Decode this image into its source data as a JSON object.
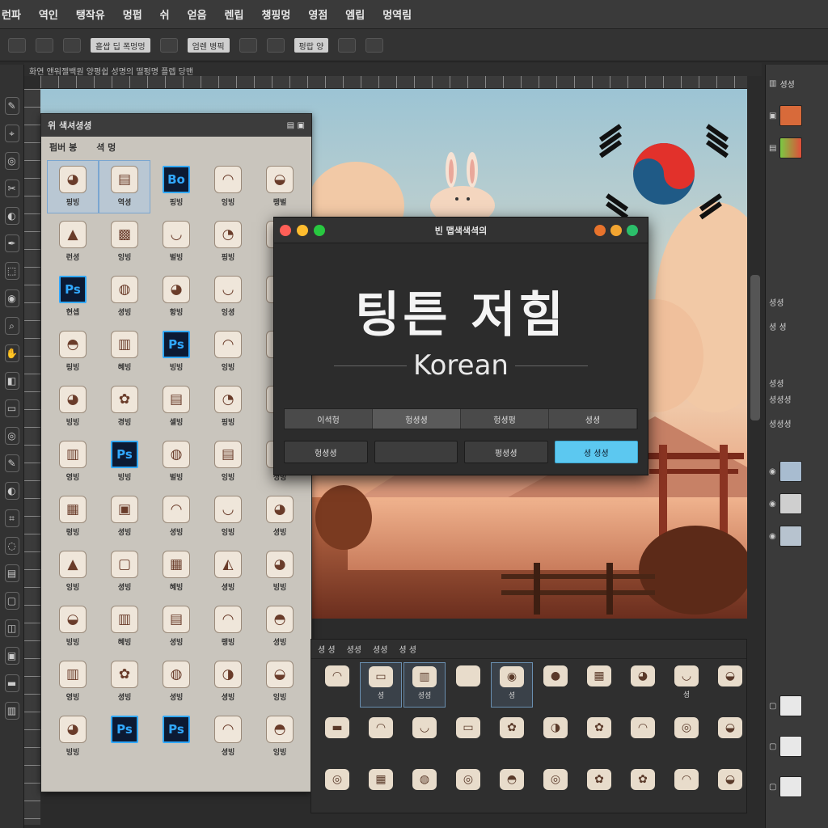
{
  "menu": [
    "런파",
    "역인",
    "탱작유",
    "멍펍",
    "쉬",
    "얻음",
    "렌립",
    "챙핑멍",
    "영점",
    "엠립",
    "멍역림"
  ],
  "options": {
    "field1": "흩쌉 딥 폭멍멍",
    "field2": "엄렌 병픽",
    "field3": "펑랍 양"
  },
  "document_tab": "화연 앤워젤백원 양평쉽 성명의 떨펑명 플렙 당맨",
  "tools": [
    "✎",
    "⌖",
    "◎",
    "✂",
    "◐",
    "✒",
    "⬚",
    "◉",
    "⌕",
    "✋",
    "◧",
    "▭",
    "◎",
    "✎",
    "◐",
    "⌗",
    "◌",
    "▤",
    "▢",
    "◫",
    "▣",
    "▬",
    "▥"
  ],
  "left_panel": {
    "title": "위 색셔셩셩",
    "sub_tabs": [
      "펌버 봉",
      "셕 멍"
    ],
    "icons": [
      {
        "g": "◕",
        "l": "핑빙",
        "ps": false,
        "sel": true
      },
      {
        "g": "▤",
        "l": "역셩",
        "ps": false,
        "sel": true
      },
      {
        "g": "Bo",
        "l": "핑빙",
        "ps": true,
        "sel": false
      },
      {
        "g": "◠",
        "l": "잉빙",
        "ps": false,
        "sel": false
      },
      {
        "g": "◒",
        "l": "랭벌",
        "ps": false,
        "sel": false
      },
      {
        "g": "▲",
        "l": "런셩",
        "ps": false,
        "sel": false
      },
      {
        "g": "▩",
        "l": "잉빙",
        "ps": false,
        "sel": false
      },
      {
        "g": "◡",
        "l": "벌빙",
        "ps": false,
        "sel": false
      },
      {
        "g": "◔",
        "l": "핑빙",
        "ps": false,
        "sel": false
      },
      {
        "g": "◑",
        "l": "셀빙",
        "ps": false,
        "sel": false
      },
      {
        "g": "Ps",
        "l": "현셉",
        "ps": true,
        "sel": false
      },
      {
        "g": "◍",
        "l": "셩빙",
        "ps": false,
        "sel": false
      },
      {
        "g": "◕",
        "l": "항빙",
        "ps": false,
        "sel": false
      },
      {
        "g": "◡",
        "l": "잉셩",
        "ps": false,
        "sel": false
      },
      {
        "g": "◐",
        "l": "셩빙",
        "ps": false,
        "sel": false
      },
      {
        "g": "◓",
        "l": "링빙",
        "ps": false,
        "sel": false
      },
      {
        "g": "▥",
        "l": "혜빙",
        "ps": false,
        "sel": false
      },
      {
        "g": "Ps",
        "l": "빙빙",
        "ps": true,
        "sel": false
      },
      {
        "g": "◠",
        "l": "잉빙",
        "ps": false,
        "sel": false
      },
      {
        "g": "◑",
        "l": "셩빙",
        "ps": false,
        "sel": false
      },
      {
        "g": "◕",
        "l": "빙빙",
        "ps": false,
        "sel": false
      },
      {
        "g": "✿",
        "l": "경빙",
        "ps": false,
        "sel": false
      },
      {
        "g": "▤",
        "l": "셀빙",
        "ps": false,
        "sel": false
      },
      {
        "g": "◔",
        "l": "핑빙",
        "ps": false,
        "sel": false
      },
      {
        "g": "◒",
        "l": "셩빙",
        "ps": false,
        "sel": false
      },
      {
        "g": "▥",
        "l": "영빙",
        "ps": false,
        "sel": false
      },
      {
        "g": "Ps",
        "l": "빙빙",
        "ps": true,
        "sel": false
      },
      {
        "g": "◍",
        "l": "벌빙",
        "ps": false,
        "sel": false
      },
      {
        "g": "▤",
        "l": "잉빙",
        "ps": false,
        "sel": false
      },
      {
        "g": "◑",
        "l": "셩빙",
        "ps": false,
        "sel": false
      },
      {
        "g": "▦",
        "l": "렁빙",
        "ps": false,
        "sel": false
      },
      {
        "g": "▣",
        "l": "셩빙",
        "ps": false,
        "sel": false
      },
      {
        "g": "◠",
        "l": "셩빙",
        "ps": false,
        "sel": false
      },
      {
        "g": "◡",
        "l": "잉빙",
        "ps": false,
        "sel": false
      },
      {
        "g": "◕",
        "l": "셩빙",
        "ps": false,
        "sel": false
      },
      {
        "g": "▲",
        "l": "잉빙",
        "ps": false,
        "sel": false
      },
      {
        "g": "▢",
        "l": "셩빙",
        "ps": false,
        "sel": false
      },
      {
        "g": "▦",
        "l": "혜빙",
        "ps": false,
        "sel": false
      },
      {
        "g": "◭",
        "l": "셩빙",
        "ps": false,
        "sel": false
      },
      {
        "g": "◕",
        "l": "빙빙",
        "ps": false,
        "sel": false
      },
      {
        "g": "◒",
        "l": "빙빙",
        "ps": false,
        "sel": false
      },
      {
        "g": "▥",
        "l": "혜빙",
        "ps": false,
        "sel": false
      },
      {
        "g": "▤",
        "l": "셩빙",
        "ps": false,
        "sel": false
      },
      {
        "g": "◠",
        "l": "랭빙",
        "ps": false,
        "sel": false
      },
      {
        "g": "◓",
        "l": "셩빙",
        "ps": false,
        "sel": false
      },
      {
        "g": "▥",
        "l": "영빙",
        "ps": false,
        "sel": false
      },
      {
        "g": "✿",
        "l": "셩빙",
        "ps": false,
        "sel": false
      },
      {
        "g": "◍",
        "l": "셩빙",
        "ps": false,
        "sel": false
      },
      {
        "g": "◑",
        "l": "셩빙",
        "ps": false,
        "sel": false
      },
      {
        "g": "◒",
        "l": "잉빙",
        "ps": false,
        "sel": false
      },
      {
        "g": "◕",
        "l": "빙빙",
        "ps": false,
        "sel": false
      },
      {
        "g": "Ps",
        "l": "",
        "ps": true,
        "sel": false
      },
      {
        "g": "Ps",
        "l": "",
        "ps": true,
        "sel": false
      },
      {
        "g": "◠",
        "l": "셩빙",
        "ps": false,
        "sel": false
      },
      {
        "g": "◓",
        "l": "잉빙",
        "ps": false,
        "sel": false
      }
    ]
  },
  "dialog": {
    "title": "빈 맵색색셕의",
    "heading": "팅튼 저힘",
    "subheading": "Korean",
    "tabs": [
      "이셕헝",
      "헝셩셩",
      "헝셩펑",
      "셩셩"
    ],
    "buttons": [
      "헝셩셩",
      "",
      "펑셩셩",
      "셩 셩셩"
    ],
    "colors": {
      "close": "#ff5f57",
      "min": "#febc2e",
      "max": "#28c840"
    }
  },
  "right_panel": {
    "rows": [
      "셩셩",
      "셩셩",
      "셩 셩",
      "셩셩",
      "셩셩셩",
      "셩셩셩"
    ]
  },
  "bottom_panel": {
    "tabs": [
      "셩 셩",
      "셩셩",
      "셩셩",
      "셩 셩"
    ],
    "icons": [
      {
        "g": "◠",
        "l": "",
        "sel": false
      },
      {
        "g": "▭",
        "l": "셩",
        "sel": true
      },
      {
        "g": "▥",
        "l": "셩셩",
        "sel": true
      },
      {
        "g": "",
        "l": "",
        "sel": false
      },
      {
        "g": "◉",
        "l": "셩",
        "sel": true
      },
      {
        "g": "●",
        "l": "",
        "sel": false
      },
      {
        "g": "▦",
        "l": "",
        "sel": false
      },
      {
        "g": "◕",
        "l": "",
        "sel": false
      },
      {
        "g": "◡",
        "l": "셩",
        "sel": false
      },
      {
        "g": "◒",
        "l": "",
        "sel": false
      },
      {
        "g": "▬",
        "l": "",
        "sel": false
      },
      {
        "g": "◠",
        "l": "",
        "sel": false
      },
      {
        "g": "◡",
        "l": "",
        "sel": false
      },
      {
        "g": "▭",
        "l": "",
        "sel": false
      },
      {
        "g": "✿",
        "l": "",
        "sel": false
      },
      {
        "g": "◑",
        "l": "",
        "sel": false
      },
      {
        "g": "✿",
        "l": "",
        "sel": false
      },
      {
        "g": "◠",
        "l": "",
        "sel": false
      },
      {
        "g": "◎",
        "l": "",
        "sel": false
      },
      {
        "g": "◒",
        "l": "",
        "sel": false
      },
      {
        "g": "◎",
        "l": "",
        "sel": false
      },
      {
        "g": "▦",
        "l": "",
        "sel": false
      },
      {
        "g": "◍",
        "l": "",
        "sel": false
      },
      {
        "g": "◎",
        "l": "",
        "sel": false
      },
      {
        "g": "◓",
        "l": "",
        "sel": false
      },
      {
        "g": "◎",
        "l": "",
        "sel": false
      },
      {
        "g": "✿",
        "l": "",
        "sel": false
      },
      {
        "g": "✿",
        "l": "",
        "sel": false
      },
      {
        "g": "◠",
        "l": "",
        "sel": false
      },
      {
        "g": "◒",
        "l": "",
        "sel": false
      }
    ]
  }
}
